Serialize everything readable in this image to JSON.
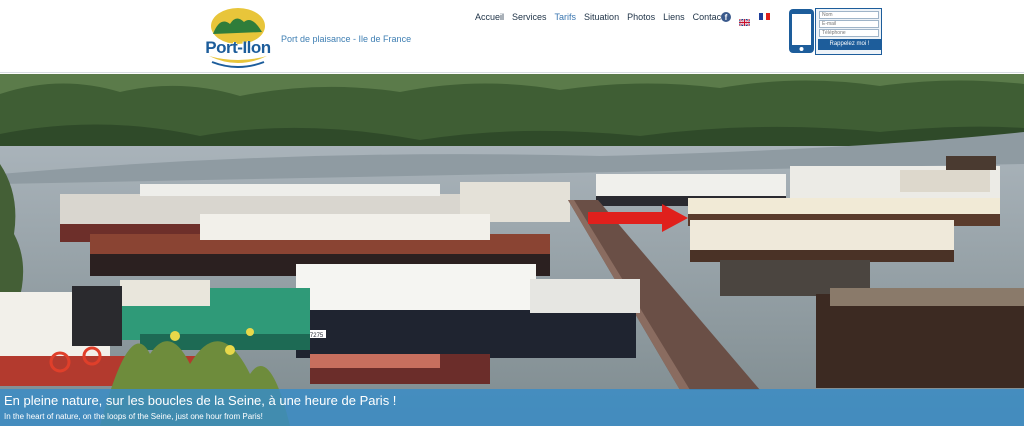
{
  "brand": {
    "name": "Port-Ilon",
    "tagline": "Port de plaisance - Ile de France"
  },
  "nav": {
    "items": [
      {
        "label": "Accueil"
      },
      {
        "label": "Services"
      },
      {
        "label": "Tarifs"
      },
      {
        "label": "Situation"
      },
      {
        "label": "Photos"
      },
      {
        "label": "Liens"
      },
      {
        "label": "Contact"
      }
    ],
    "icons": [
      "facebook-icon",
      "uk-flag-icon",
      "french-flag-icon"
    ]
  },
  "callback": {
    "name_placeholder": "Nom",
    "email_placeholder": "E-mail",
    "phone_placeholder": "Téléphone",
    "button_label": "Rappelez moi !"
  },
  "hero": {
    "caption_fr": "En pleine nature, sur les boucles de la Seine, à une heure de Paris !",
    "caption_en": "In the heart of nature, on the loops of the Seine, just one hour from Paris!",
    "boat_plate": "P 17275"
  },
  "colors": {
    "brand_blue": "#1d5d9b",
    "nav_text": "#1e3246",
    "caption_band": "#378cc8",
    "arrow_red": "#e0201c"
  }
}
